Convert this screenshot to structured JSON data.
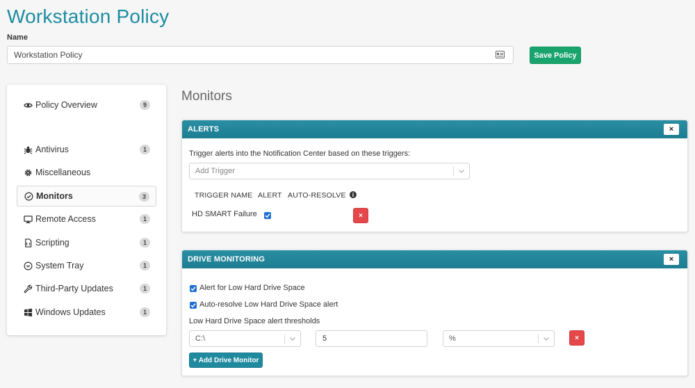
{
  "page": {
    "title": "Workstation Policy",
    "name_label": "Name",
    "name_value": "Workstation Policy",
    "save_label": "Save Policy"
  },
  "sidebar": {
    "items": [
      {
        "label": "Policy Overview",
        "count": "9",
        "icon": "eye-icon"
      },
      {
        "label": "Antivirus",
        "count": "1",
        "icon": "bug-icon"
      },
      {
        "label": "Miscellaneous",
        "count": "",
        "icon": "gear-icon"
      },
      {
        "label": "Monitors",
        "count": "3",
        "icon": "check-circle-icon",
        "active": true
      },
      {
        "label": "Remote Access",
        "count": "1",
        "icon": "monitor-icon"
      },
      {
        "label": "Scripting",
        "count": "1",
        "icon": "script-file-icon"
      },
      {
        "label": "System Tray",
        "count": "1",
        "icon": "chevron-circle-icon"
      },
      {
        "label": "Third-Party Updates",
        "count": "1",
        "icon": "wrench-icon"
      },
      {
        "label": "Windows Updates",
        "count": "1",
        "icon": "windows-icon"
      }
    ]
  },
  "main": {
    "section_title": "Monitors",
    "alerts": {
      "header": "ALERTS",
      "close": "×",
      "description": "Trigger alerts into the Notification Center based on these triggers:",
      "trigger_placeholder": "Add Trigger",
      "columns": [
        "TRIGGER NAME",
        "ALERT",
        "AUTO-RESOLVE"
      ],
      "rows": [
        {
          "name": "HD SMART Failure",
          "alert": true,
          "delete": "×"
        }
      ]
    },
    "drive_monitoring": {
      "header": "DRIVE MONITORING",
      "close": "×",
      "low_space_alert": "Alert for Low Hard Drive Space",
      "auto_resolve": "Auto-resolve Low Hard Drive Space alert",
      "thresholds_label": "Low Hard Drive Space alert thresholds",
      "drive_value": "C:\\",
      "threshold_value": "5",
      "unit_value": "%",
      "delete": "×",
      "add_button": "+ Add Drive Monitor"
    }
  },
  "colors": {
    "accent": "#1d8ca0",
    "save_green": "#19a46e",
    "danger": "#e5484b",
    "checkbox_blue": "#1f6fd1"
  }
}
